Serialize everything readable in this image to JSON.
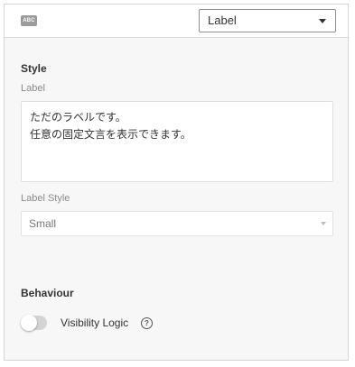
{
  "header": {
    "component_icon": "abc-icon",
    "component_icon_text": "ABC",
    "type_select_value": "Label"
  },
  "style_section": {
    "title": "Style",
    "label_field_label": "Label",
    "label_value": "ただのラベルです。\n任意の固定文言を表示できます。",
    "label_style_field_label": "Label Style",
    "label_style_value": "Small"
  },
  "behaviour_section": {
    "title": "Behaviour",
    "visibility_logic_label": "Visibility Logic",
    "visibility_logic_enabled": false,
    "help_icon": "question-circle-icon",
    "help_glyph": "?"
  }
}
